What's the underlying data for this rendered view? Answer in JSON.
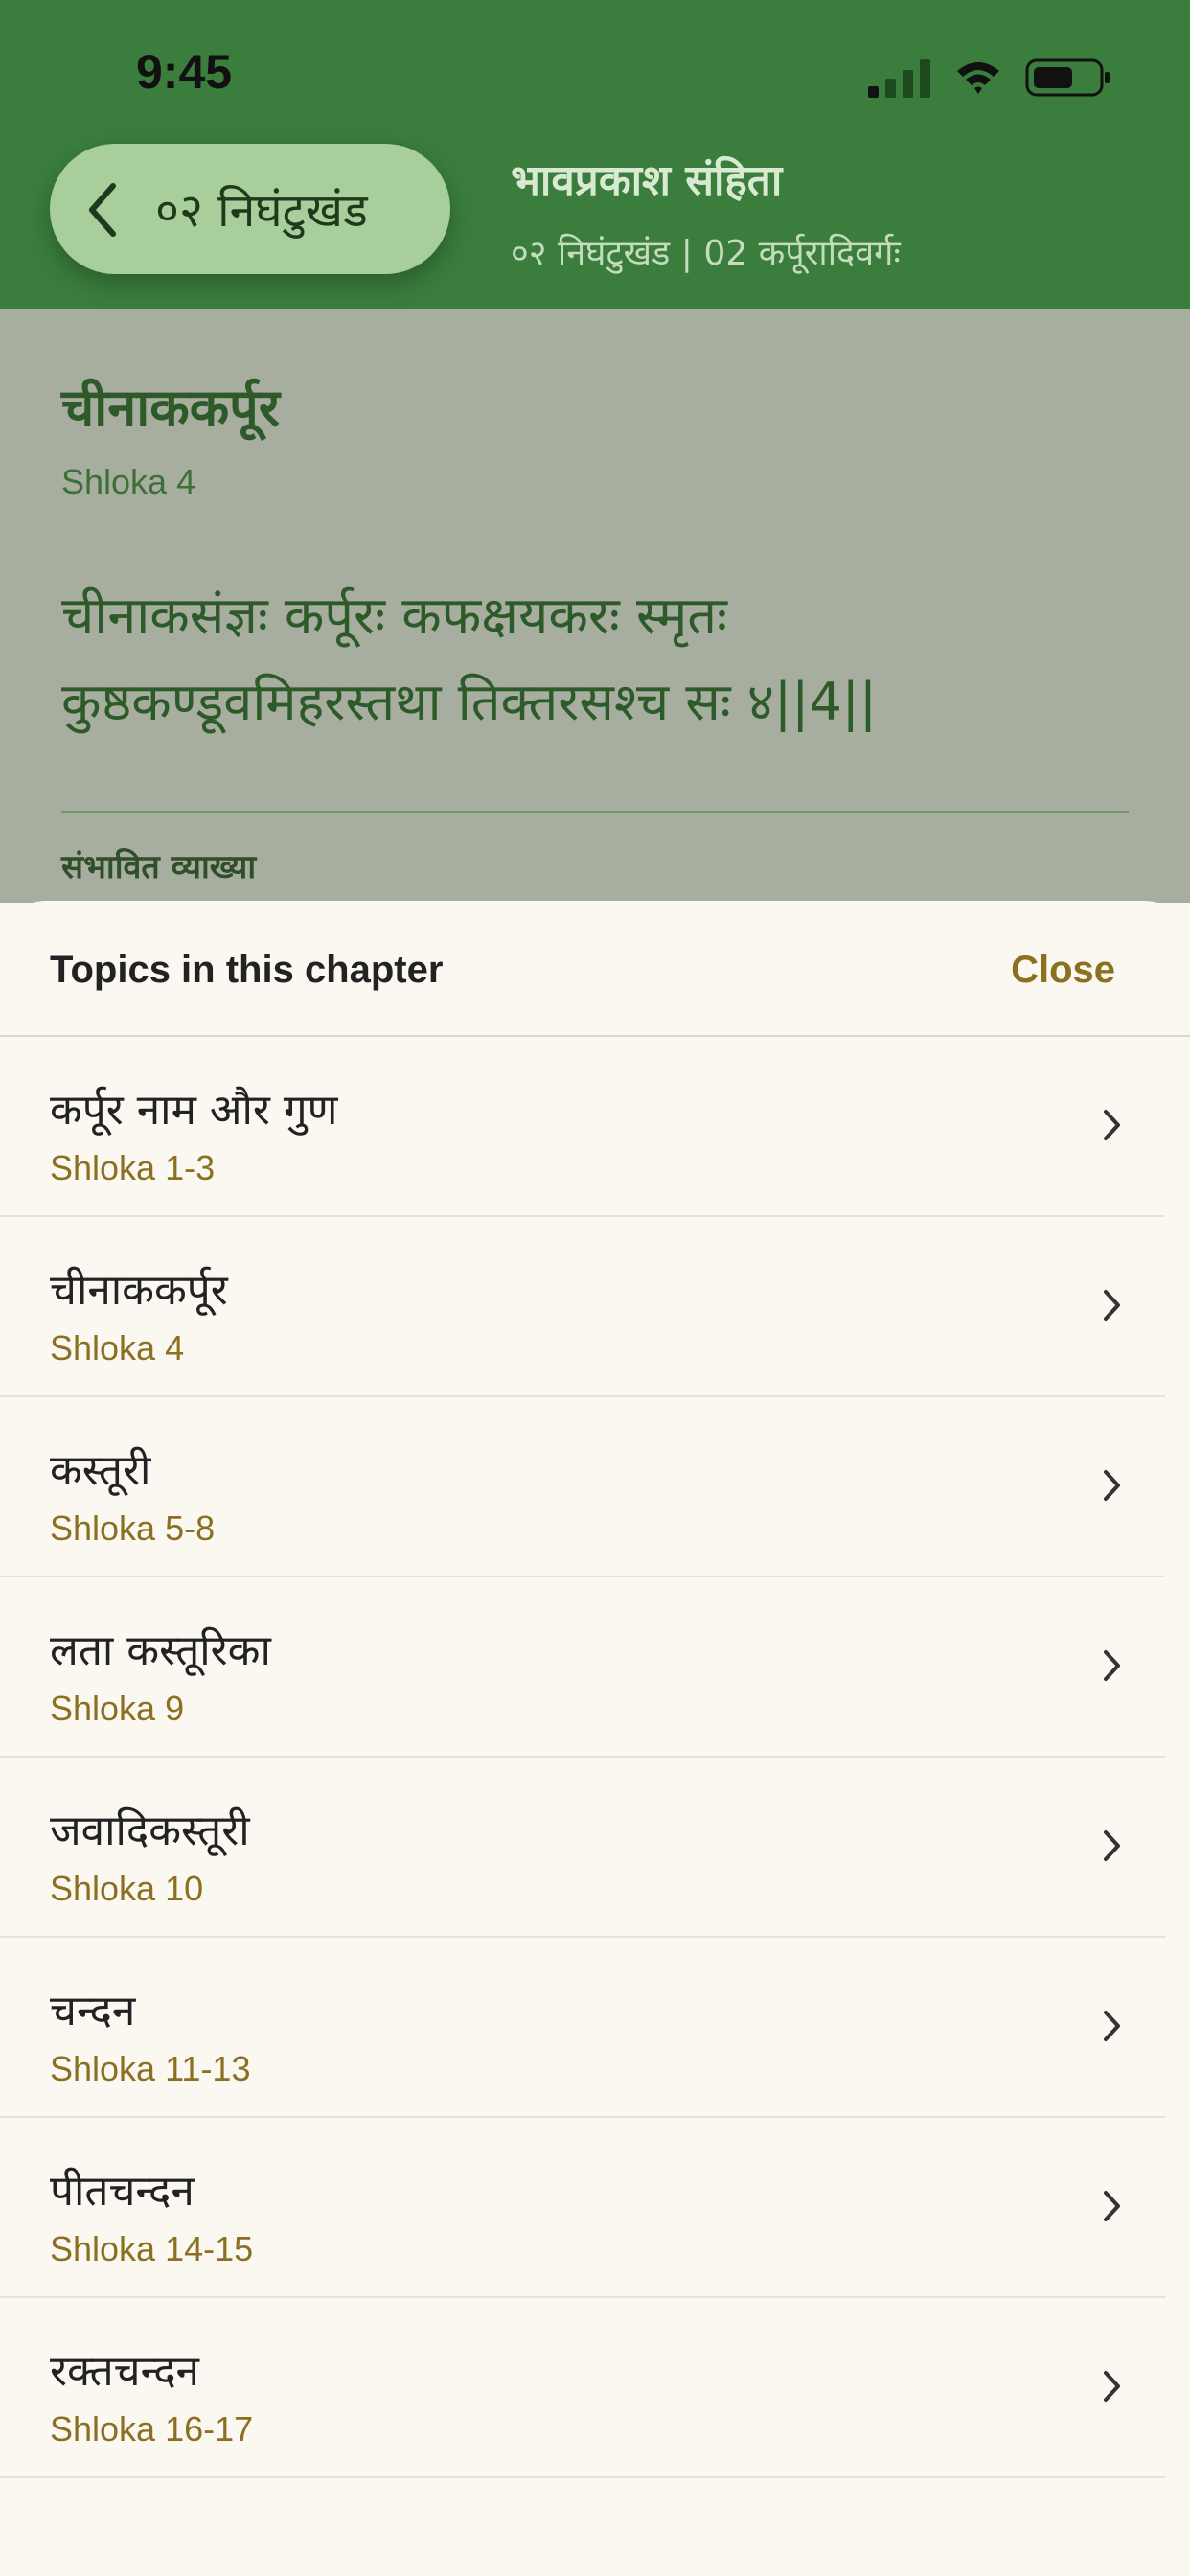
{
  "status_bar": {
    "time": "9:45",
    "icons": [
      "cellular-signal-icon",
      "wifi-icon",
      "battery-icon"
    ]
  },
  "header": {
    "back_label": "०२ निघंटुखंड",
    "title": "भावप्रकाश संहिता",
    "subtitle": "०२ निघंटुखंड | 02 कर्पूरादिवर्गः"
  },
  "verse_card": {
    "title": "चीनाककर्पूर",
    "shloka_label": "Shloka 4",
    "verse_line1": "चीनाकसंज्ञः कर्पूरः कफक्षयकरः स्मृतः",
    "verse_line2": "कुष्ठकण्डूवमिहरस्तथा तिक्तरसश्च सः ४||4||",
    "explanation_heading": "संभावित व्याख्या"
  },
  "sheet": {
    "title": "Topics in this chapter",
    "close_label": "Close",
    "topics": [
      {
        "name": "कर्पूर नाम और गुण",
        "range": "Shloka 1-3"
      },
      {
        "name": "चीनाककर्पूर",
        "range": "Shloka 4"
      },
      {
        "name": "कस्तूरी",
        "range": "Shloka 5-8"
      },
      {
        "name": "लता कस्तूरिका",
        "range": "Shloka 9"
      },
      {
        "name": "जवादिकस्तूरी",
        "range": "Shloka 10"
      },
      {
        "name": "चन्दन",
        "range": "Shloka 11-13"
      },
      {
        "name": "पीतचन्दन",
        "range": "Shloka 14-15"
      },
      {
        "name": "रक्तचन्दन",
        "range": "Shloka 16-17"
      }
    ]
  },
  "colors": {
    "header_green": "#3a7d3c",
    "accent_gold": "#8a7020",
    "sheet_bg": "#fbf8f2"
  }
}
